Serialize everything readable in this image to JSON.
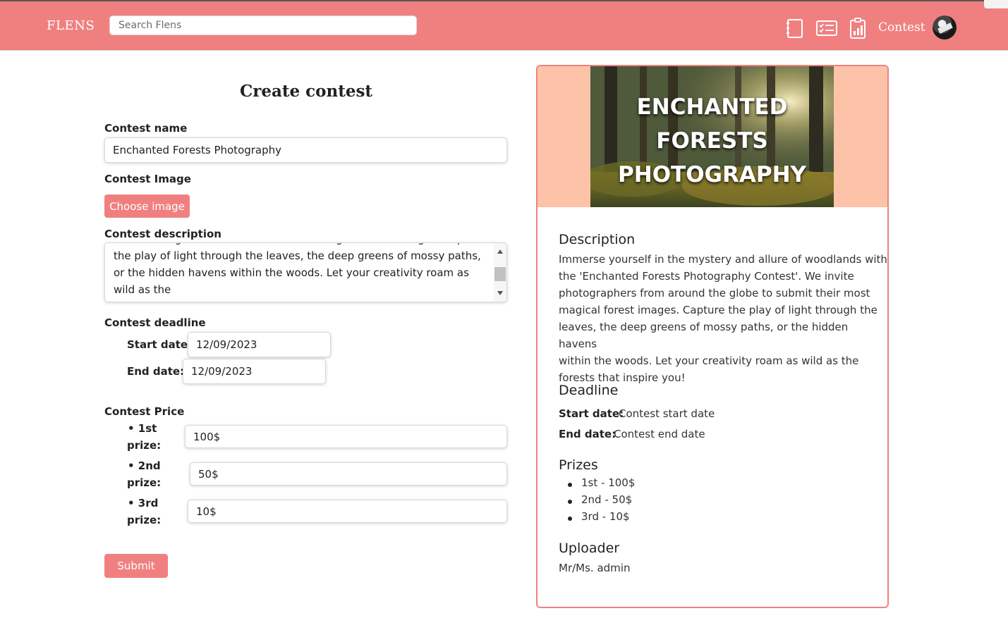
{
  "navbar": {
    "brand": "FLENS",
    "search_placeholder": "Search Flens",
    "icons": [
      "notebook-icon",
      "checklist-icon",
      "clipboard-chart-icon"
    ],
    "contest_link": "Contest",
    "avatar": "user-avatar"
  },
  "form": {
    "title": "Create contest",
    "contest_name_label": "Contest name",
    "contest_name_value": "Enchanted Forests Photography",
    "image_label": "Contest Image",
    "choose_image_label": "Choose image",
    "description_label": "Contest description",
    "description_value": "around the globe to submit their most magical forest images. Capture the play of light through the leaves, the deep greens of mossy paths, or the hidden havens within the woods. Let your creativity roam as wild as the",
    "deadline_label": "Contest deadline",
    "start_label": "Start date:",
    "start_value": "12/09/2023",
    "end_label": "End date:",
    "end_value": "12/09/2023",
    "price_label": "Contest Price",
    "prizes": [
      {
        "line1": "• 1st",
        "line2": "prize:",
        "value": "100$"
      },
      {
        "line1": "• 2nd",
        "line2": "prize:",
        "value": "50$"
      },
      {
        "line1": "• 3rd",
        "line2": "prize:",
        "value": "10$"
      }
    ],
    "submit_label": "Submit"
  },
  "preview": {
    "banner_line1": "ENCHANTED",
    "banner_line2": "FORESTS",
    "banner_line3": "PHOTOGRAPHY",
    "banner_color": "#fcc3a8",
    "description_heading": "Description",
    "description_lines": [
      "Immerse yourself in the mystery and allure of woodlands with",
      "the 'Enchanted Forests Photography Contest'. We invite",
      "photographers from around the globe to submit their most",
      "magical forest images. Capture the play of light through the",
      "leaves, the deep greens of mossy paths, or the hidden havens",
      "within the woods. Let your creativity roam as wild as the",
      "forests that inspire you!"
    ],
    "deadline_heading": "Deadline",
    "start_label": "Start date:",
    "start_value": "Contest start date",
    "end_label": "End date:",
    "end_value": "Contest end date",
    "prizes_heading": "Prizes",
    "prizes": [
      "1st - 100$",
      "2nd - 50$",
      "3rd - 10$"
    ],
    "uploader_heading": "Uploader",
    "uploader_value": "Mr/Ms. admin"
  },
  "colors": {
    "accent": "#f08080",
    "banner_bg": "#fcc3a8"
  }
}
